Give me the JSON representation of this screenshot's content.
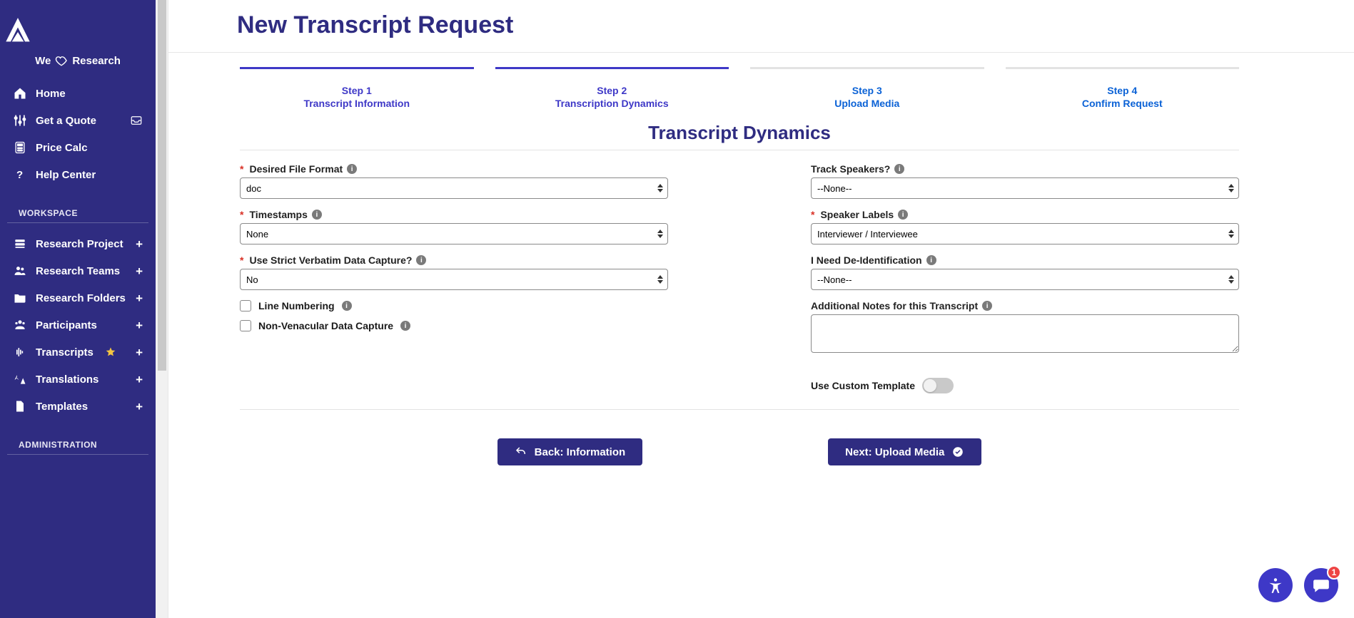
{
  "tagline": {
    "left": "We",
    "right": "Research"
  },
  "sidebar": {
    "top": [
      {
        "label": "Home"
      },
      {
        "label": "Get a Quote"
      },
      {
        "label": "Price Calc"
      },
      {
        "label": "Help Center"
      }
    ],
    "section_workspace": "WORKSPACE",
    "workspace": [
      {
        "label": "Research Project"
      },
      {
        "label": "Research Teams"
      },
      {
        "label": "Research Folders"
      },
      {
        "label": "Participants"
      },
      {
        "label": "Transcripts"
      },
      {
        "label": "Translations"
      },
      {
        "label": "Templates"
      }
    ],
    "section_admin": "ADMINISTRATION"
  },
  "page": {
    "title": "New Transcript Request",
    "section_title": "Transcript Dynamics"
  },
  "steps": [
    {
      "num": "Step 1",
      "label": "Transcript Information"
    },
    {
      "num": "Step 2",
      "label": "Transcription Dynamics"
    },
    {
      "num": "Step 3",
      "label": "Upload Media"
    },
    {
      "num": "Step 4",
      "label": "Confirm Request"
    }
  ],
  "form": {
    "file_format_label": "Desired File Format",
    "file_format_value": "doc",
    "timestamps_label": "Timestamps",
    "timestamps_value": "None",
    "strict_label": "Use Strict Verbatim Data Capture?",
    "strict_value": "No",
    "line_numbering_label": "Line Numbering",
    "nonvern_label": "Non-Venacular Data Capture",
    "track_speakers_label": "Track Speakers?",
    "track_speakers_value": "--None--",
    "speaker_labels_label": "Speaker Labels",
    "speaker_labels_value": "Interviewer / Interviewee",
    "deident_label": "I Need De-Identification",
    "deident_value": "--None--",
    "notes_label": "Additional Notes for this Transcript",
    "custom_template_label": "Use Custom Template"
  },
  "buttons": {
    "back": "Back: Information",
    "next": "Next: Upload Media"
  },
  "fab": {
    "badge": "1"
  }
}
